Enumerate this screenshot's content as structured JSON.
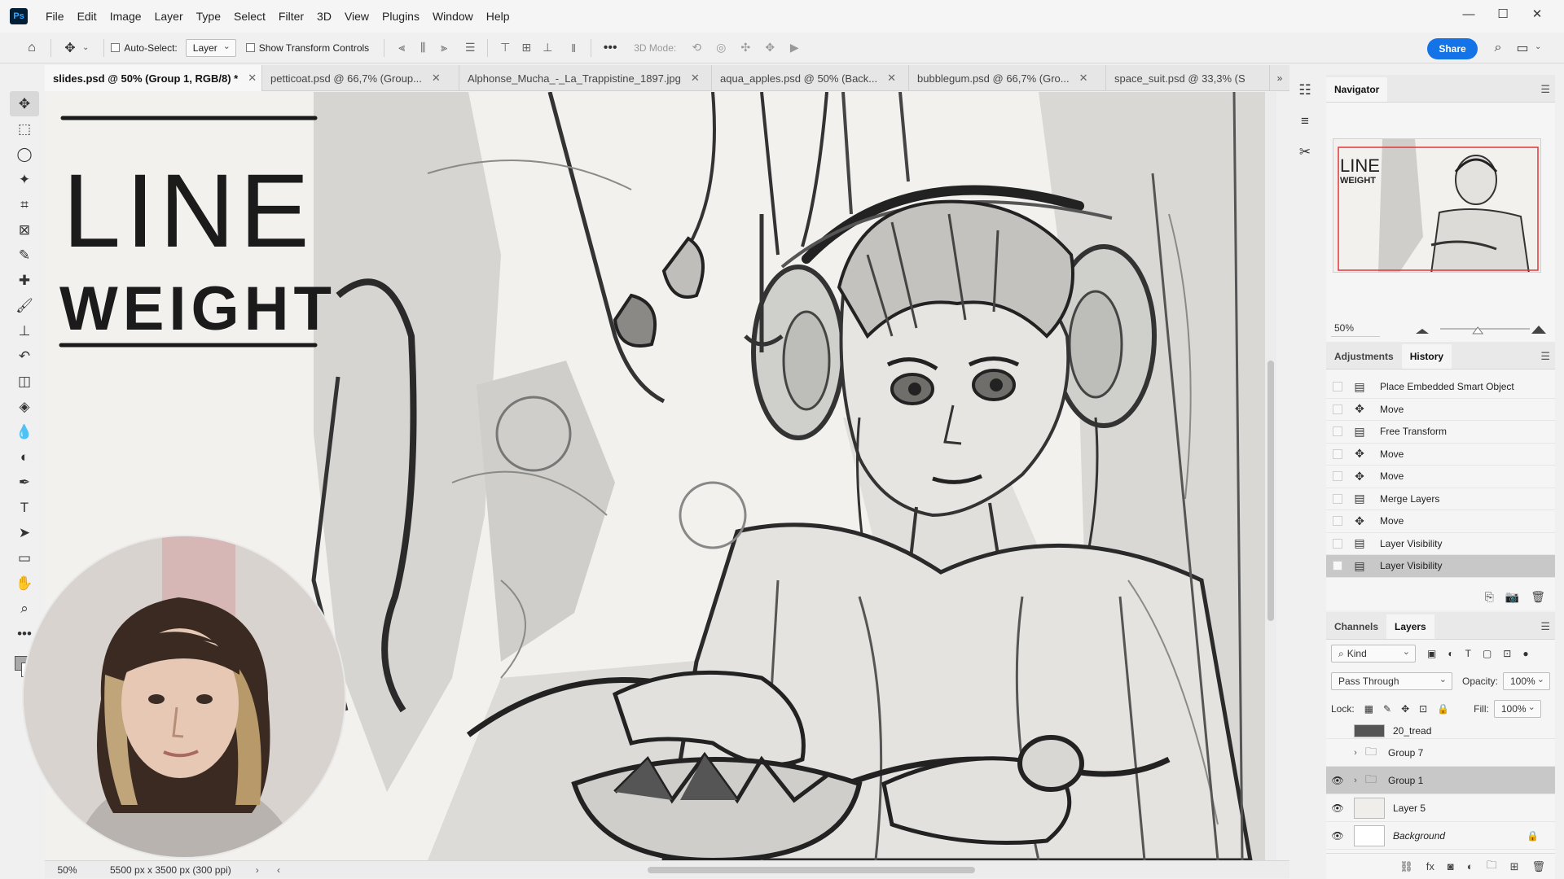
{
  "app": {
    "logo": "Ps"
  },
  "menu": [
    "File",
    "Edit",
    "Image",
    "Layer",
    "Type",
    "Select",
    "Filter",
    "3D",
    "View",
    "Plugins",
    "Window",
    "Help"
  ],
  "window_controls": {
    "minimize": "—",
    "maximize": "☐",
    "close": "✕"
  },
  "options": {
    "auto_select_label": "Auto-Select:",
    "auto_select_value": "Layer",
    "show_transform_label": "Show Transform Controls",
    "mode3d_label": "3D Mode:",
    "share_label": "Share"
  },
  "tabs": [
    {
      "label": "slides.psd @ 50% (Group 1, RGB/8) *",
      "active": true
    },
    {
      "label": "petticoat.psd @ 66,7% (Group...",
      "active": false
    },
    {
      "label": "Alphonse_Mucha_-_La_Trappistine_1897.jpg",
      "active": false
    },
    {
      "label": "aqua_apples.psd @ 50% (Back...",
      "active": false
    },
    {
      "label": "bubblegum.psd @ 66,7% (Gro...",
      "active": false
    },
    {
      "label": "space_suit.psd @ 33,3% (S",
      "active": false
    }
  ],
  "canvas_text": {
    "line1": "LINE",
    "line2": "WEIGHT"
  },
  "status": {
    "zoom": "50%",
    "doc_size": "5500 px x 3500 px (300 ppi)"
  },
  "navigator": {
    "title": "Navigator",
    "zoom": "50%",
    "thumb_text1": "LINE",
    "thumb_text2": "WEIGHT",
    "slider_position": 0.42
  },
  "history_panel": {
    "tabs": [
      "Adjustments",
      "History"
    ],
    "active_tab": "History",
    "items": [
      {
        "label": "Place Embedded Smart Object",
        "icon": "smart-object-icon"
      },
      {
        "label": "Move",
        "icon": "move-icon"
      },
      {
        "label": "Free Transform",
        "icon": "free-transform-icon"
      },
      {
        "label": "Move",
        "icon": "move-icon"
      },
      {
        "label": "Move",
        "icon": "move-icon"
      },
      {
        "label": "Merge Layers",
        "icon": "merge-layers-icon"
      },
      {
        "label": "Move",
        "icon": "move-icon"
      },
      {
        "label": "Layer Visibility",
        "icon": "layer-visibility-icon"
      },
      {
        "label": "Layer Visibility",
        "icon": "layer-visibility-icon",
        "active": true
      }
    ]
  },
  "layers_panel": {
    "tabs": [
      "Channels",
      "Layers"
    ],
    "active_tab": "Layers",
    "kind_label": "Kind",
    "blend_mode": "Pass Through",
    "opacity_label": "Opacity:",
    "opacity_value": "100%",
    "lock_label": "Lock:",
    "fill_label": "Fill:",
    "fill_value": "100%",
    "layers": [
      {
        "name": "20_tread",
        "type": "layer",
        "visible": false
      },
      {
        "name": "Group 7",
        "type": "group",
        "visible": false
      },
      {
        "name": "Group 1",
        "type": "group",
        "visible": true,
        "active": true
      },
      {
        "name": "Layer 5",
        "type": "layer",
        "visible": true
      },
      {
        "name": "Background",
        "type": "layer",
        "visible": true,
        "locked": true
      }
    ]
  },
  "colors": {
    "accent": "#1473e6",
    "active_row": "#c8c8c8"
  }
}
